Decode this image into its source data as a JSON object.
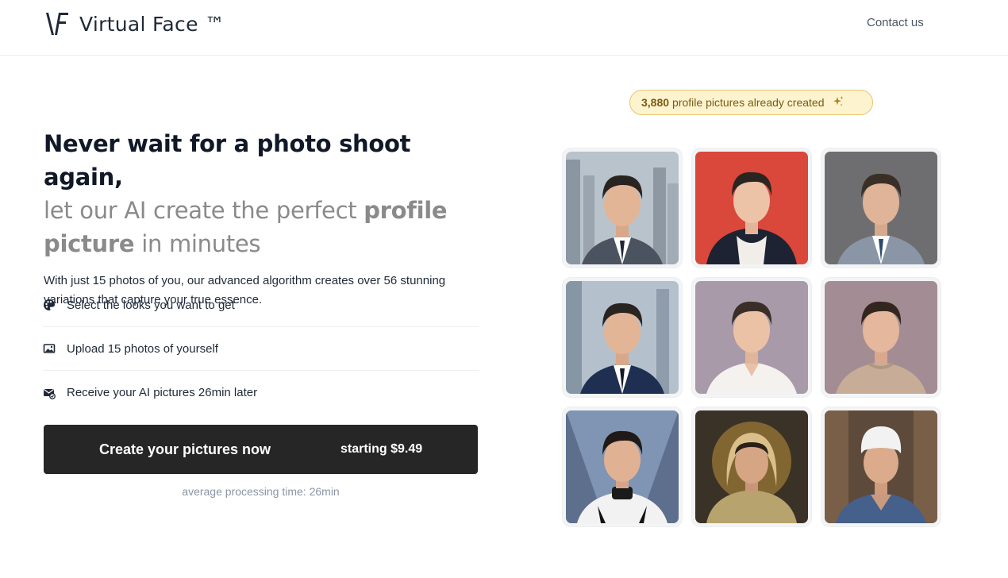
{
  "header": {
    "brand": "Virtual Face ™",
    "contact_label": "Contact us"
  },
  "hero": {
    "headline_strong": "Never wait for a photo shoot again,",
    "headline_part1": "let our AI create the perfect ",
    "headline_bold": "profile picture",
    "headline_part2": " in minutes",
    "description": "With just 15 photos of you, our advanced algorithm creates over 56 stunning variations that capture your true essence."
  },
  "steps": [
    {
      "icon": "palette-icon",
      "label": "Select the looks you want to get"
    },
    {
      "icon": "image-icon",
      "label": "Upload 15 photos of yourself"
    },
    {
      "icon": "mail-check-icon",
      "label": "Receive your AI pictures 26min later"
    }
  ],
  "cta": {
    "label": "Create your pictures now",
    "price": "starting $9.49",
    "note": "average processing time: 26min"
  },
  "badge": {
    "count": "3,880",
    "text": "profile pictures already created",
    "icon": "sparkles-icon"
  },
  "gallery": [
    {
      "style": "suit-city"
    },
    {
      "style": "hoodie-red"
    },
    {
      "style": "suit-gray"
    },
    {
      "style": "navy-suit-city"
    },
    {
      "style": "white-shirt-purple"
    },
    {
      "style": "sweater-mauve"
    },
    {
      "style": "racing-suit"
    },
    {
      "style": "glowing-hoodie"
    },
    {
      "style": "chef-scrubs"
    }
  ],
  "colors": {
    "cta_bg": "#262626",
    "badge_bg": "#fdf4cf",
    "badge_border": "#e9c46a",
    "muted_text": "#8a8a8a"
  }
}
